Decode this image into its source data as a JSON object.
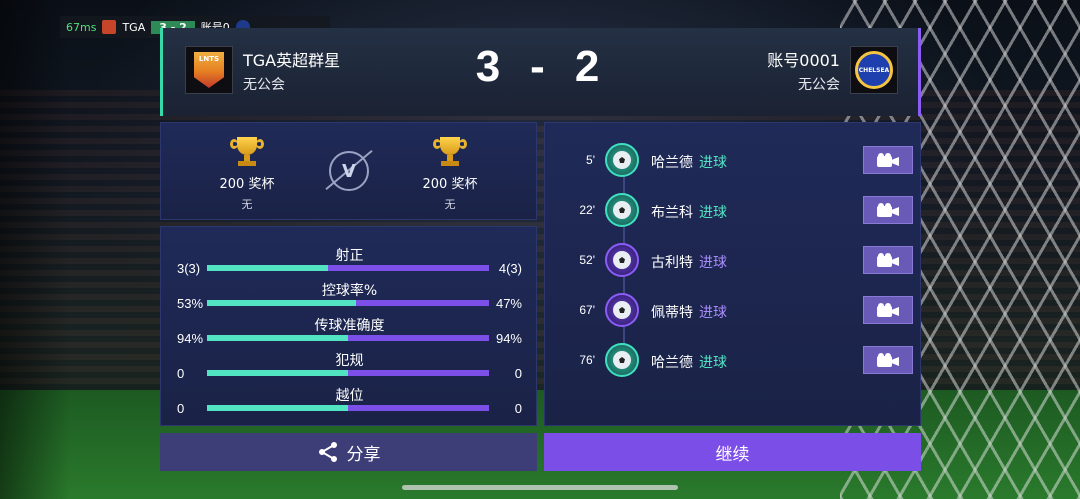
{
  "hud": {
    "ping": "67ms",
    "home_abbr": "TGA",
    "score": "3 - 2",
    "away_abbr": "账号0"
  },
  "header": {
    "home": {
      "name": "TGA英超群星",
      "guild": "无公会",
      "badge_text": "LNTS"
    },
    "away": {
      "name": "账号0001",
      "guild": "无公会",
      "badge_text": "CHELSEA"
    },
    "score_home": "3",
    "score_sep": "-",
    "score_away": "2"
  },
  "trophies": {
    "home": {
      "count": "200 奖杯",
      "sub": "无"
    },
    "away": {
      "count": "200 奖杯",
      "sub": "无"
    },
    "vs": "V"
  },
  "stats": [
    {
      "label": "射正",
      "home": "3(3)",
      "away": "4(3)",
      "home_share": 0.43
    },
    {
      "label": "控球率%",
      "home": "53%",
      "away": "47%",
      "home_share": 0.53
    },
    {
      "label": "传球准确度",
      "home": "94%",
      "away": "94%",
      "home_share": 0.5
    },
    {
      "label": "犯规",
      "home": "0",
      "away": "0",
      "home_share": 0.5
    },
    {
      "label": "越位",
      "home": "0",
      "away": "0",
      "home_share": 0.5
    }
  ],
  "events": [
    {
      "minute": "5'",
      "player": "哈兰德",
      "type": "进球",
      "team": "teal"
    },
    {
      "minute": "22'",
      "player": "布兰科",
      "type": "进球",
      "team": "teal"
    },
    {
      "minute": "52'",
      "player": "古利特",
      "type": "进球",
      "team": "purple"
    },
    {
      "minute": "67'",
      "player": "佩蒂特",
      "type": "进球",
      "team": "purple"
    },
    {
      "minute": "76'",
      "player": "哈兰德",
      "type": "进球",
      "team": "teal"
    }
  ],
  "buttons": {
    "share": "分享",
    "continue": "继续"
  },
  "colors": {
    "home_accent": "#52e3c2",
    "away_accent": "#7b4fe8",
    "continue_bg": "#7c4ee8",
    "share_bg": "#3d3e78"
  }
}
